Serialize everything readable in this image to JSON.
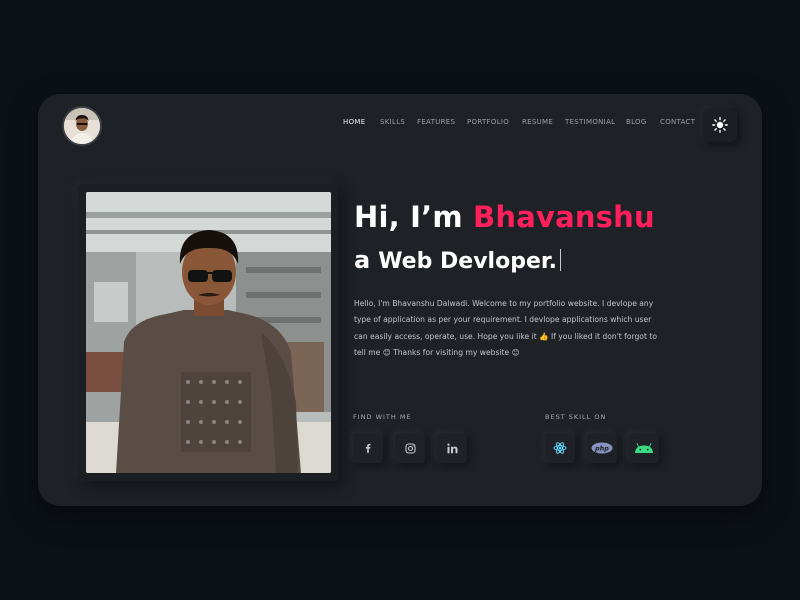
{
  "nav": {
    "items": [
      "HOME",
      "SKILLS",
      "FEATURES",
      "PORTFOLIO",
      "RESUME",
      "TESTIMONIAL",
      "BLOG",
      "CONTACT"
    ],
    "active": "HOME"
  },
  "hero": {
    "greeting": "Hi, I’m ",
    "name": "Bhavanshu",
    "prefix": "a",
    "role": "Web Devloper."
  },
  "about": "Hello,  I'm Bhavanshu Dalwadi.  Welcome to my portfolio website.  I devlope any type of application as per your requirement.  I devlope applications which user can easily access, operate, use.  Hope you like it 👍  If you liked it don't forgot to tell me 😊  Thanks for visiting my website 😊",
  "social": {
    "label": "FIND WITH ME",
    "icons": [
      "facebook-icon",
      "instagram-icon",
      "linkedin-icon"
    ]
  },
  "skills": {
    "label": "BEST SKILL ON",
    "icons": [
      "react-icon",
      "php-icon",
      "android-icon"
    ]
  },
  "icons": {
    "theme_toggle": "sun-icon"
  },
  "colors": {
    "accent": "#ff1f5a",
    "page_bg": "#0c1118",
    "card_bg": "#1e2227",
    "android": "#3ddc84",
    "react": "#61dafb",
    "php": "#8892bf"
  }
}
